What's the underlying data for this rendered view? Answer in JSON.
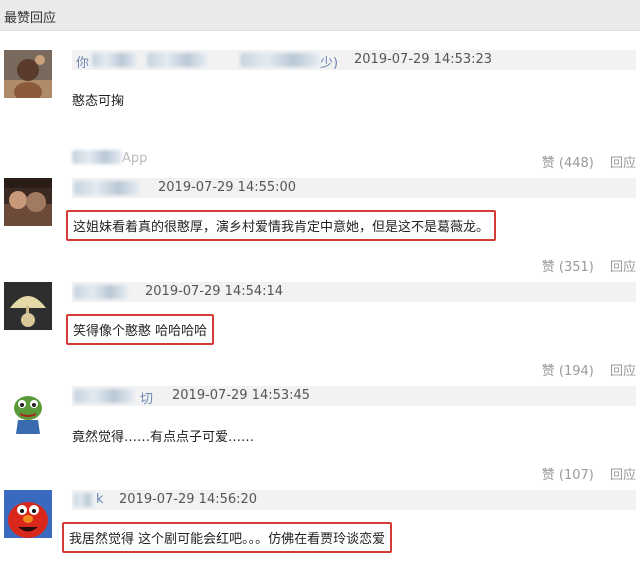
{
  "section": {
    "title": "最赞回应"
  },
  "comments": [
    {
      "username_suffix": "少)",
      "time": "2019-07-29 14:53:23",
      "text": "憨态可掬",
      "source_suffix": "App",
      "like_label": "赞",
      "like_count": "(448)",
      "reply_label": "回应"
    },
    {
      "time": "2019-07-29 14:55:00",
      "text": "这姐妹看着真的很憨厚，演乡村爱情我肯定中意她，但是这不是葛薇龙。",
      "like_label": "赞",
      "like_count": "(351)",
      "reply_label": "回应"
    },
    {
      "time": "2019-07-29 14:54:14",
      "text": "笑得像个憨憨 哈哈哈哈",
      "like_label": "赞",
      "like_count": "(194)",
      "reply_label": "回应"
    },
    {
      "username_suffix": "切",
      "time": "2019-07-29 14:53:45",
      "text": "竟然觉得……有点点子可爱……",
      "like_label": "赞",
      "like_count": "(107)",
      "reply_label": "回应"
    },
    {
      "username_suffix": "k",
      "time": "2019-07-29 14:56:20",
      "text": "我居然觉得 这个剧可能会红吧。。。仿佛在看贾玲谈恋爱"
    }
  ],
  "colors": {
    "highlight_border": "#d23b36",
    "username": "#6b87b3",
    "meta_bar": "#f2f2f2"
  },
  "avatar_icons": [
    "avatar-figure-icon",
    "avatar-sunset-photo-icon",
    "avatar-cartoon-character-icon",
    "avatar-pepe-frog-icon",
    "avatar-elmo-icon"
  ]
}
